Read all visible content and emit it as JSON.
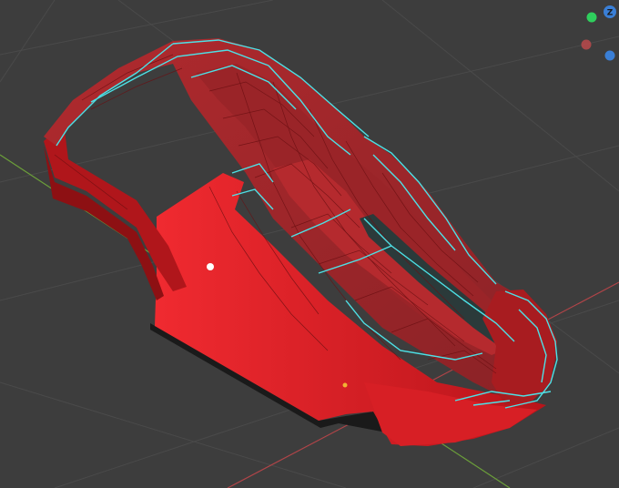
{
  "viewport": {
    "background_color": "#3d3d3d",
    "grid_color": "#4a4a4a",
    "x_axis_color": "#b04448",
    "y_axis_color": "#6b9e3a"
  },
  "model": {
    "base_color": "#c4161c",
    "shade_color": "#7a0f12",
    "edge_highlight_color": "#4de1e6"
  },
  "gizmo": {
    "z_label": "Z",
    "x_color": "#c34a4c",
    "y_color": "#2fcf5d",
    "z_color": "#3a7fd6",
    "icons": [
      "y-axis-dot-icon",
      "x-axis-dot-icon",
      "z-axis-dot-icon"
    ]
  },
  "light_icon": "light-icon",
  "origin_icon": "origin-dot-icon"
}
